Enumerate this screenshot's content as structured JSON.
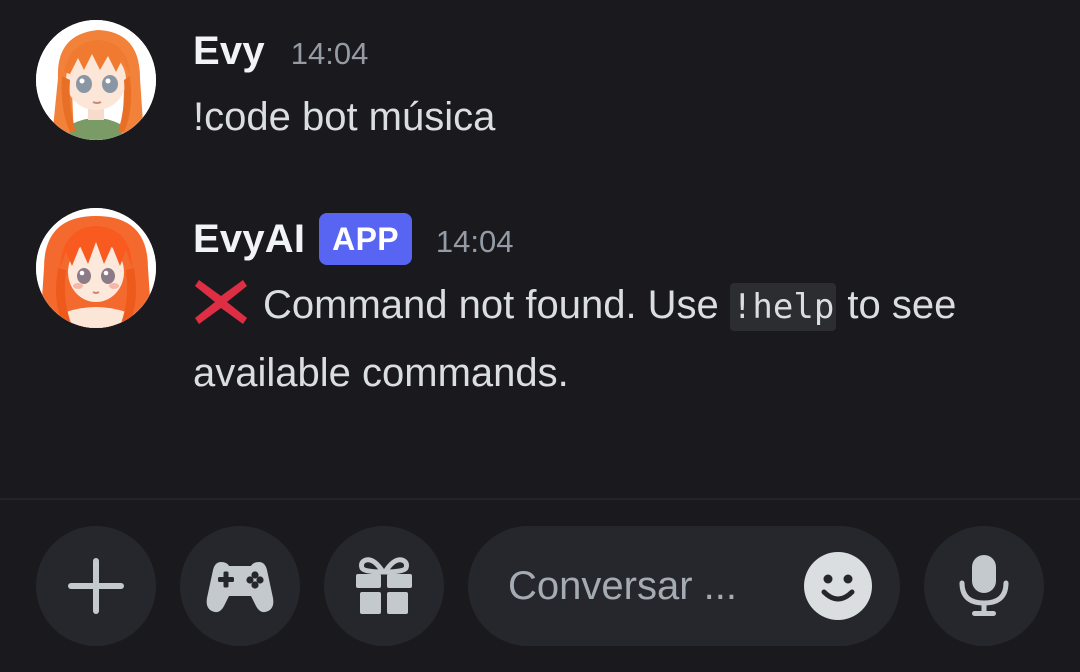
{
  "messages": [
    {
      "username": "Evy",
      "timestamp": "14:04",
      "text": "!code bot música"
    },
    {
      "username": "EvyAI",
      "badge": "APP",
      "timestamp": "14:04",
      "emoji_icon": "cross-mark-icon",
      "text_before": "Command not found. Use",
      "code": "!help",
      "text_after": "to see available commands."
    }
  ],
  "composer": {
    "placeholder": "Conversar ...",
    "buttons": [
      "plus-icon",
      "gamepad-icon",
      "gift-icon",
      "microphone-icon"
    ],
    "emoji_button": "smiley-icon"
  },
  "colors": {
    "background": "#1a1a1e",
    "badge": "#5865f2",
    "cross": "#dd2e44",
    "button": "#26272c"
  }
}
